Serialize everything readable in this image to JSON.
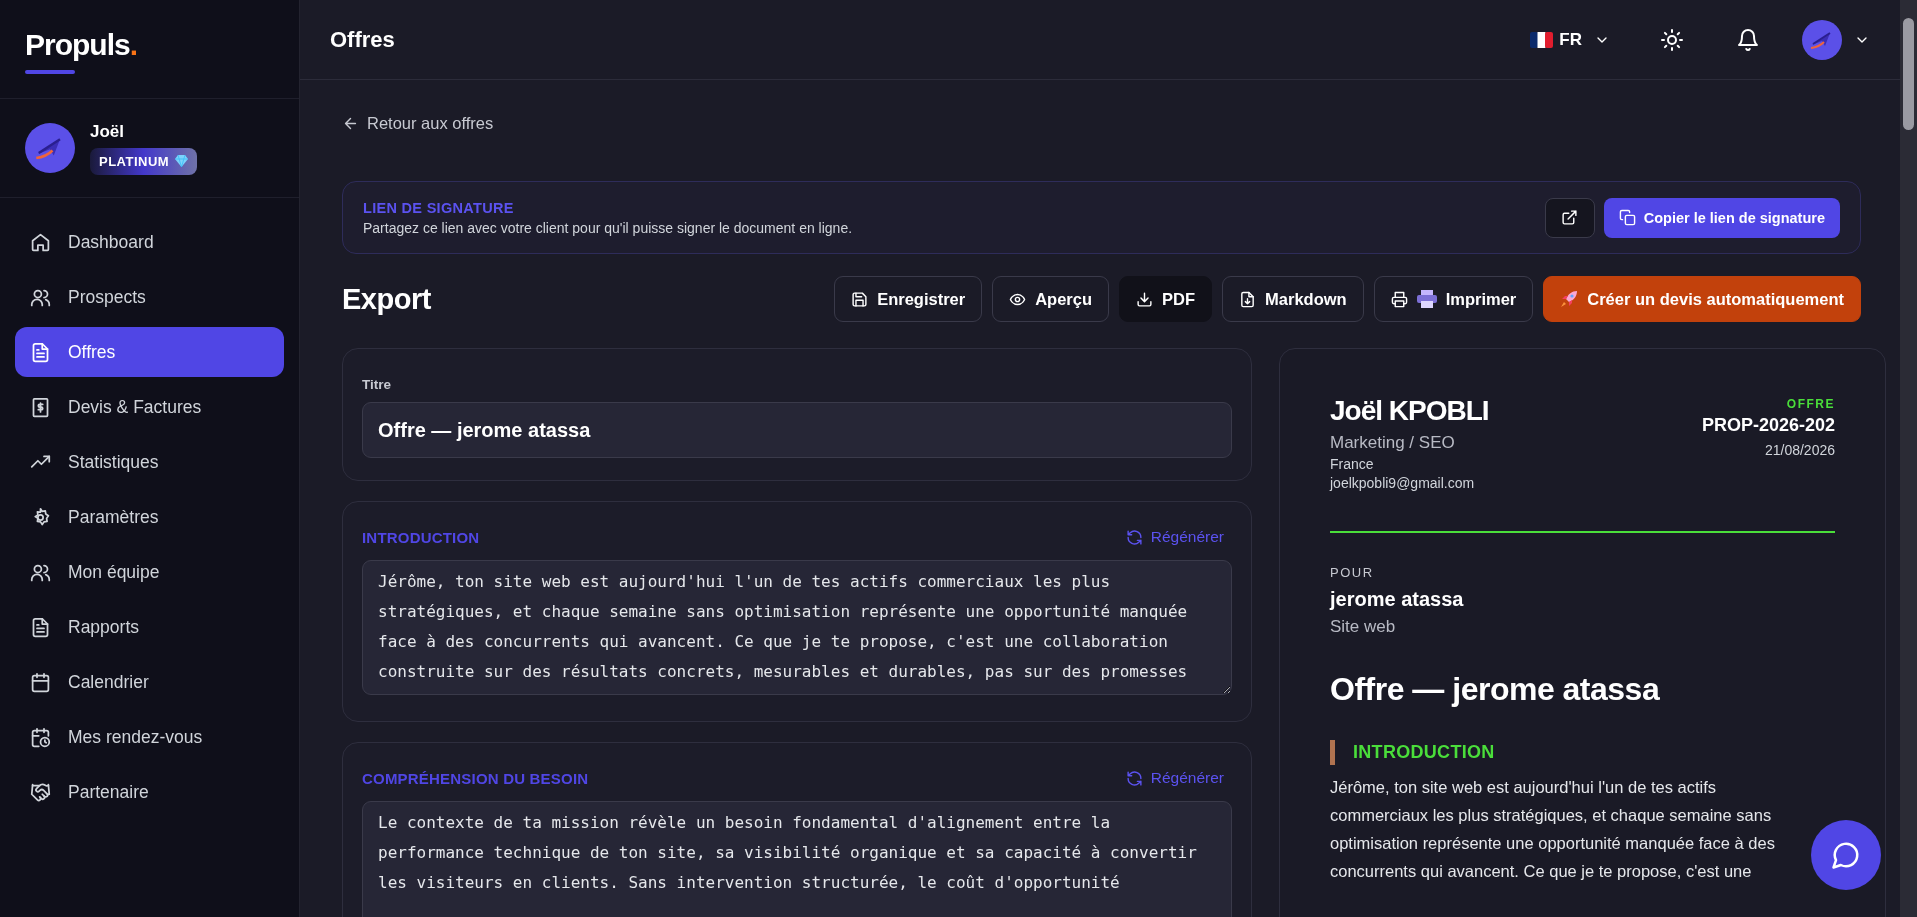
{
  "sidebar": {
    "logo": {
      "name": "Propuls",
      "mark": "."
    },
    "user": {
      "name": "Joël",
      "badge": "PLATINUM"
    },
    "items": [
      {
        "label": "Dashboard",
        "selected": false
      },
      {
        "label": "Prospects",
        "selected": false
      },
      {
        "label": "Offres",
        "selected": true
      },
      {
        "label": "Devis & Factures",
        "selected": false
      },
      {
        "label": "Statistiques",
        "selected": false
      },
      {
        "label": "Paramètres",
        "selected": false
      },
      {
        "label": "Mon équipe",
        "selected": false
      },
      {
        "label": "Rapports",
        "selected": false
      },
      {
        "label": "Calendrier",
        "selected": false
      },
      {
        "label": "Mes rendez-vous",
        "selected": false
      },
      {
        "label": "Partenaire",
        "selected": false
      }
    ]
  },
  "header": {
    "title": "Offres",
    "language": "FR"
  },
  "back_link": "Retour aux offres",
  "signature_banner": {
    "title": "LIEN DE SIGNATURE",
    "description": "Partagez ce lien avec votre client pour qu'il puisse signer le document en ligne.",
    "copy_button": "Copier le lien de signature"
  },
  "export": {
    "title": "Export",
    "buttons": [
      {
        "label": "Enregistrer",
        "kind": "outline"
      },
      {
        "label": "Aperçu",
        "kind": "outline"
      },
      {
        "label": "PDF",
        "kind": "dark"
      },
      {
        "label": "Markdown",
        "kind": "outline"
      },
      {
        "label": "Imprimer",
        "kind": "outline"
      },
      {
        "label": "Créer un devis automatiquement",
        "kind": "accent"
      }
    ]
  },
  "editor": {
    "title_field": {
      "label": "Titre",
      "value": "Offre — jerome atassa"
    },
    "sections": [
      {
        "heading": "INTRODUCTION",
        "action": "Régénérer",
        "text": "Jérôme, ton site web est aujourd'hui l'un de tes actifs commerciaux les plus stratégiques, et chaque semaine sans optimisation représente une opportunité manquée face à des concurrents qui avancent. Ce que je te propose, c'est une collaboration construite sur des résultats concrets, mesurables et durables, pas sur des promesses"
      },
      {
        "heading": "COMPRÉHENSION DU BESOIN",
        "action": "Régénérer",
        "text": "Le contexte de ta mission révèle un besoin fondamental d'alignement entre la performance technique de ton site, sa visibilité organique et sa capacité à convertir les visiteurs en clients. Sans intervention structurée, le coût d'opportunité"
      }
    ]
  },
  "preview": {
    "sender": {
      "name": "Joël KPOBLI",
      "role": "Marketing / SEO",
      "country": "France",
      "email": "joelkpobli9@gmail.com"
    },
    "doc_type": "OFFRE",
    "number": "PROP-2026-202",
    "date": "21/08/2026",
    "for_label": "POUR",
    "client": "jerome atassa",
    "project": "Site web",
    "title": "Offre — jerome atassa",
    "sections": [
      {
        "heading": "INTRODUCTION",
        "text": "Jérôme, ton site web est aujourd'hui l'un de tes actifs commerciaux les plus stratégiques, et chaque semaine sans optimisation représente une opportunité manquée face à des concurrents qui avancent. Ce que je te propose, c'est une"
      }
    ]
  }
}
